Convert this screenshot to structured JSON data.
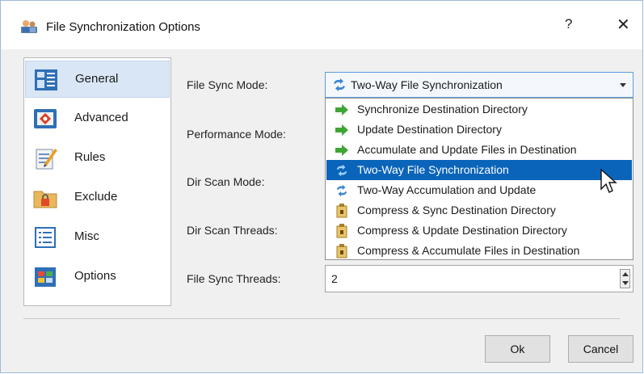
{
  "window": {
    "title": "File Synchronization Options",
    "help_glyph": "?",
    "close_glyph": "✕"
  },
  "sidebar": {
    "items": [
      {
        "label": "General",
        "icon": "general-icon",
        "selected": true
      },
      {
        "label": "Advanced",
        "icon": "advanced-icon",
        "selected": false
      },
      {
        "label": "Rules",
        "icon": "rules-icon",
        "selected": false
      },
      {
        "label": "Exclude",
        "icon": "exclude-icon",
        "selected": false
      },
      {
        "label": "Misc",
        "icon": "misc-icon",
        "selected": false
      },
      {
        "label": "Options",
        "icon": "options-icon",
        "selected": false
      }
    ]
  },
  "form": {
    "file_sync_mode_label": "File Sync Mode:",
    "performance_mode_label": "Performance Mode:",
    "dir_scan_mode_label": "Dir Scan Mode:",
    "dir_scan_threads_label": "Dir Scan Threads:",
    "file_sync_threads_label": "File Sync Threads:",
    "file_sync_mode_value": "Two-Way File Synchronization",
    "file_sync_threads_value": "2"
  },
  "dropdown": {
    "options": [
      {
        "label": "Synchronize Destination Directory",
        "icon": "green-arrow-icon"
      },
      {
        "label": "Update Destination Directory",
        "icon": "green-arrow-icon"
      },
      {
        "label": "Accumulate and Update Files in Destination",
        "icon": "green-arrow-icon"
      },
      {
        "label": "Two-Way File Synchronization",
        "icon": "two-way-sync-icon"
      },
      {
        "label": "Two-Way Accumulation and Update",
        "icon": "two-way-sync-icon"
      },
      {
        "label": "Compress & Sync Destination Directory",
        "icon": "compress-icon"
      },
      {
        "label": "Compress & Update Destination Directory",
        "icon": "compress-icon"
      },
      {
        "label": "Compress & Accumulate Files in Destination",
        "icon": "compress-icon"
      }
    ],
    "highlighted_index": 3
  },
  "footer": {
    "ok_label": "Ok",
    "cancel_label": "Cancel"
  },
  "colors": {
    "selection": "#0a64ba",
    "nav_selected": "#d9e6f5",
    "combo_border": "#5c9ce0"
  }
}
